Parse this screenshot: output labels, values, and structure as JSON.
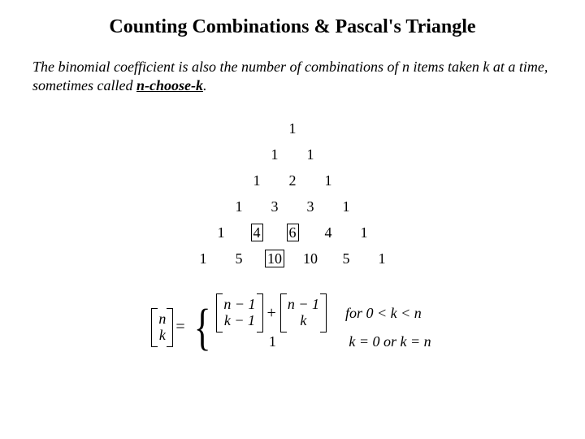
{
  "title": "Counting Combinations & Pascal's Triangle",
  "intro_part1": "The binomial coefficient is also the number of combinations of n items taken k at a time, sometimes called ",
  "intro_bold": "n-choose-k",
  "intro_part2": ".",
  "triangle": {
    "row0": {
      "c0": "1"
    },
    "row1": {
      "c0": "1",
      "c1": "1"
    },
    "row2": {
      "c0": "1",
      "c1": "2",
      "c2": "1"
    },
    "row3": {
      "c0": "1",
      "c1": "3",
      "c2": "3",
      "c3": "1"
    },
    "row4": {
      "c0": "1",
      "c1": "4",
      "c2": "6",
      "c3": "4",
      "c4": "1"
    },
    "row5": {
      "c0": "1",
      "c1": "5",
      "c2": "10",
      "c3": "10",
      "c4": "5",
      "c5": "1"
    }
  },
  "formula": {
    "lhs_top": "n",
    "lhs_bot": "k",
    "eq": "=",
    "case1_a_top": "n − 1",
    "case1_a_bot": "k − 1",
    "plus": "+",
    "case1_b_top": "n − 1",
    "case1_b_bot": "k",
    "case1_cond": "for 0 < k < n",
    "case2_val": "1",
    "case2_cond": "k = 0 or k = n"
  }
}
